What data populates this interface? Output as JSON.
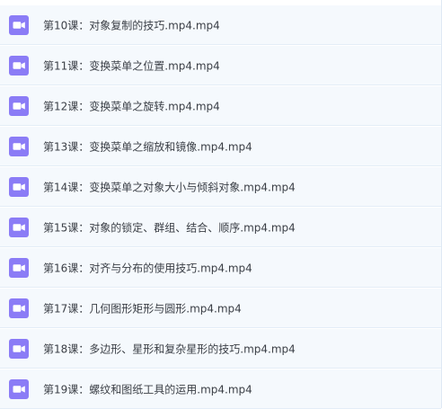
{
  "accent_color": "#8b7cf6",
  "files": [
    {
      "name": "第10课：对象复制的技巧.mp4.mp4",
      "icon": "video-file-icon"
    },
    {
      "name": "第11课：变换菜单之位置.mp4.mp4",
      "icon": "video-file-icon"
    },
    {
      "name": "第12课：变换菜单之旋转.mp4.mp4",
      "icon": "video-file-icon"
    },
    {
      "name": "第13课：变换菜单之缩放和镜像.mp4.mp4",
      "icon": "video-file-icon"
    },
    {
      "name": "第14课：变换菜单之对象大小与倾斜对象.mp4.mp4",
      "icon": "video-file-icon"
    },
    {
      "name": "第15课：对象的锁定、群组、结合、顺序.mp4.mp4",
      "icon": "video-file-icon"
    },
    {
      "name": "第16课：对齐与分布的使用技巧.mp4.mp4",
      "icon": "video-file-icon"
    },
    {
      "name": "第17课：几何图形矩形与圆形.mp4.mp4",
      "icon": "video-file-icon"
    },
    {
      "name": "第18课：多边形、星形和复杂星形的技巧.mp4.mp4",
      "icon": "video-file-icon"
    },
    {
      "name": "第19课：螺纹和图纸工具的运用.mp4.mp4",
      "icon": "video-file-icon"
    }
  ]
}
